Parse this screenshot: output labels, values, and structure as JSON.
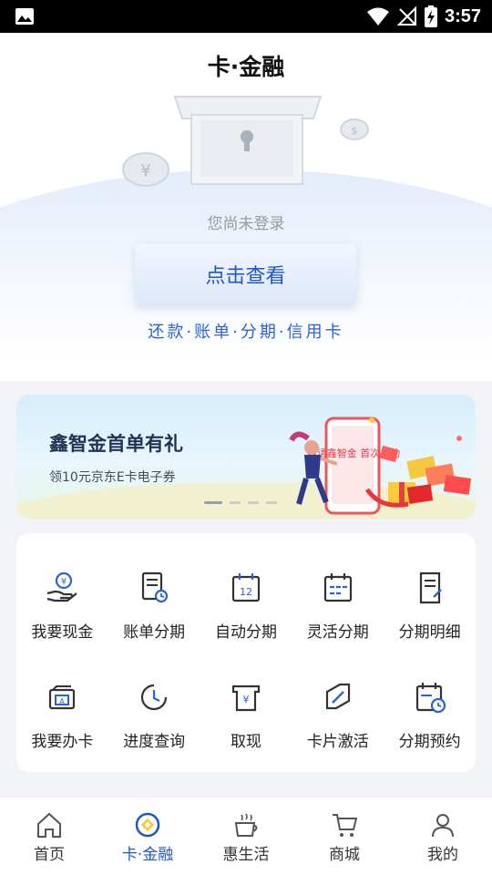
{
  "status_bar": {
    "time": "3:57"
  },
  "header": {
    "title": "卡·金融"
  },
  "hero": {
    "login_hint": "您尚未登录",
    "login_button": "点击查看",
    "links": "还款·账单·分期·信用卡"
  },
  "banner": {
    "title": "鑫智金首单有礼",
    "subtitle": "领10元京东E卡电子券",
    "phone_text": "申请鑫智金 首次成功",
    "dots": 4,
    "active_dot": 0
  },
  "services": [
    {
      "label": "我要现金",
      "icon": "cash-hand-icon"
    },
    {
      "label": "账单分期",
      "icon": "bill-clock-icon"
    },
    {
      "label": "自动分期",
      "icon": "calendar-12-icon"
    },
    {
      "label": "灵活分期",
      "icon": "calendar-grid-icon"
    },
    {
      "label": "分期明细",
      "icon": "document-edit-icon"
    },
    {
      "label": "我要办卡",
      "icon": "card-apply-icon"
    },
    {
      "label": "进度查询",
      "icon": "progress-clock-icon"
    },
    {
      "label": "取现",
      "icon": "withdraw-cash-icon"
    },
    {
      "label": "卡片激活",
      "icon": "card-activate-icon"
    },
    {
      "label": "分期预约",
      "icon": "calendar-clock-icon"
    }
  ],
  "bottom_nav": [
    {
      "label": "首页",
      "icon": "home-icon",
      "active": false
    },
    {
      "label": "卡·金融",
      "icon": "finance-target-icon",
      "active": true
    },
    {
      "label": "惠生活",
      "icon": "coffee-cup-icon",
      "active": false
    },
    {
      "label": "商城",
      "icon": "shopping-cart-icon",
      "active": false
    },
    {
      "label": "我的",
      "icon": "user-icon",
      "active": false
    }
  ],
  "colors": {
    "accent": "#1f56c9",
    "icon_blue": "#2b62d6",
    "icon_dark": "#333333"
  }
}
